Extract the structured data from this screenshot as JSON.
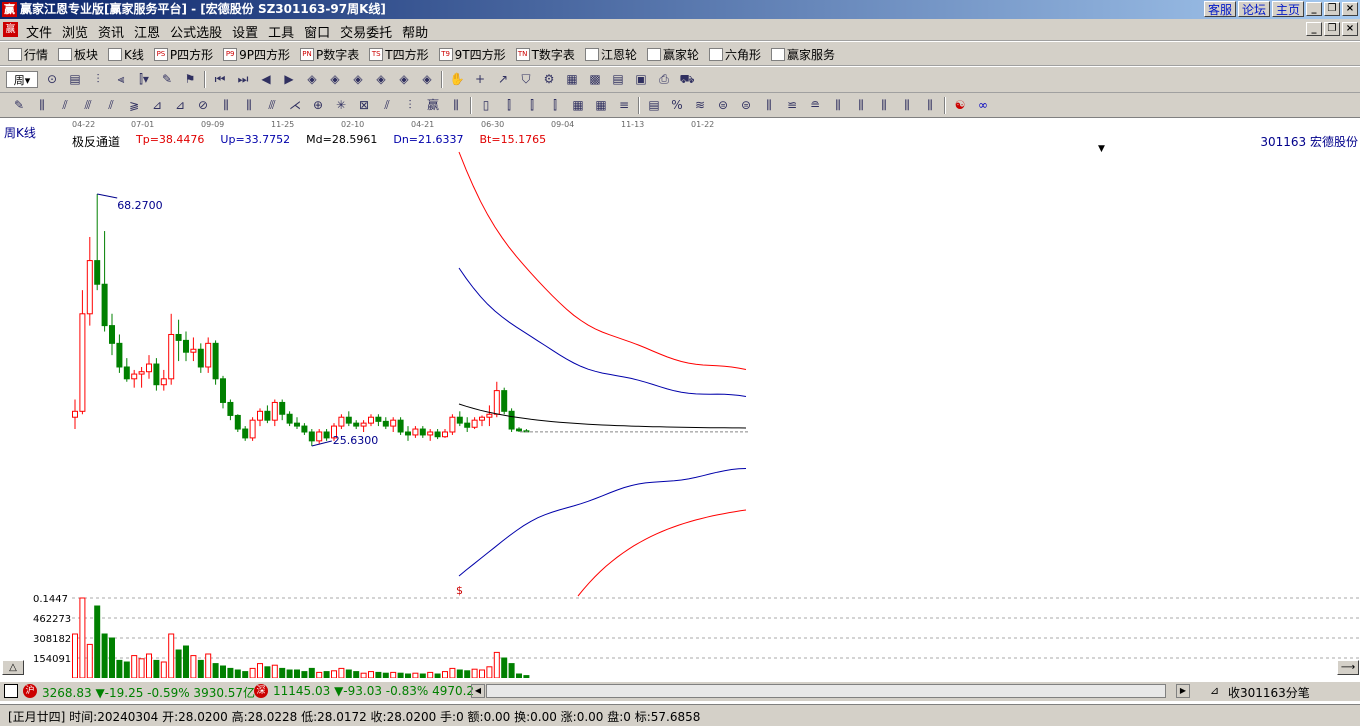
{
  "window": {
    "title": "赢家江恩专业版[赢家服务平台] - [宏德股份  SZ301163-97周K线]",
    "links": [
      "客服",
      "论坛",
      "主页"
    ]
  },
  "menu": [
    "文件",
    "浏览",
    "资讯",
    "江恩",
    "公式选股",
    "设置",
    "工具",
    "窗口",
    "交易委托",
    "帮助"
  ],
  "toolbar1": [
    {
      "label": "行情",
      "icon": "grid-icon"
    },
    {
      "label": "板块",
      "icon": "blocks-icon"
    },
    {
      "label": "K线",
      "icon": "candle-icon"
    },
    {
      "label": "P四方形",
      "icon": "PS"
    },
    {
      "label": "9P四方形",
      "icon": "P9"
    },
    {
      "label": "P数字表",
      "icon": "PN"
    },
    {
      "label": "T四方形",
      "icon": "TS"
    },
    {
      "label": "9T四方形",
      "icon": "T9"
    },
    {
      "label": "T数字表",
      "icon": "TN"
    },
    {
      "label": "江恩轮",
      "icon": "wheel-icon"
    },
    {
      "label": "赢家轮",
      "icon": "wheel-icon"
    },
    {
      "label": "六角形",
      "icon": "hexagon-icon"
    },
    {
      "label": "赢家服务",
      "icon": "dollar-icon"
    }
  ],
  "toolbar2": {
    "period": "周"
  },
  "chart": {
    "period_label": "周K线",
    "dates": [
      "04-22",
      "07-01",
      "09-09",
      "11-25",
      "02-10",
      "04-21",
      "06-30",
      "09-04",
      "11-13",
      "01-22"
    ],
    "indicator": {
      "name": "极反通道",
      "Tp": "Tp=38.4476",
      "Up": "Up=33.7752",
      "Md": "Md=28.5961",
      "Dn": "Dn=21.6337",
      "Bt": "Bt=15.1765"
    },
    "stock": "301163  宏德股份",
    "high_label": "68.2700",
    "low_label": "25.6300",
    "volume_labels": [
      "0.1447",
      "462273",
      "308182",
      "154091"
    ],
    "dollar": "$",
    "colors": {
      "up": "#ff0000",
      "down": "#008000",
      "channel_outer": "#ff0000",
      "channel_inner": "#0000aa",
      "channel_mid": "#000000",
      "text": "#00008b"
    }
  },
  "chart_data": {
    "type": "candlestick",
    "candles": [
      [
        30.5,
        33.5,
        28.5,
        31.5
      ],
      [
        31.5,
        52.0,
        31.0,
        48.0
      ],
      [
        48.0,
        61.0,
        46.0,
        57.0
      ],
      [
        57.0,
        68.27,
        52.0,
        53.0
      ],
      [
        53.0,
        62.0,
        45.0,
        46.0
      ],
      [
        46.0,
        48.0,
        41.0,
        43.0
      ],
      [
        43.0,
        44.5,
        38.0,
        39.0
      ],
      [
        39.0,
        40.5,
        36.5,
        37.0
      ],
      [
        37.0,
        38.5,
        35.5,
        37.8
      ],
      [
        37.8,
        39.0,
        35.5,
        38.2
      ],
      [
        38.2,
        41.0,
        37.0,
        39.5
      ],
      [
        39.5,
        40.5,
        35.0,
        36.0
      ],
      [
        36.0,
        38.5,
        35.0,
        37.0
      ],
      [
        37.0,
        48.0,
        36.0,
        44.5
      ],
      [
        44.5,
        47.0,
        40.0,
        43.5
      ],
      [
        43.5,
        45.0,
        40.0,
        41.5
      ],
      [
        41.5,
        44.0,
        40.0,
        42.0
      ],
      [
        42.0,
        43.0,
        38.0,
        39.0
      ],
      [
        39.0,
        44.0,
        38.0,
        43.0
      ],
      [
        43.0,
        43.5,
        36.0,
        37.0
      ],
      [
        37.0,
        37.5,
        32.0,
        33.0
      ],
      [
        33.0,
        33.5,
        30.0,
        30.8
      ],
      [
        30.8,
        31.0,
        28.0,
        28.5
      ],
      [
        28.5,
        29.0,
        26.5,
        27.0
      ],
      [
        27.0,
        30.5,
        26.5,
        30.0
      ],
      [
        30.0,
        32.0,
        29.0,
        31.5
      ],
      [
        31.5,
        32.5,
        29.5,
        30.0
      ],
      [
        30.0,
        33.5,
        29.0,
        33.0
      ],
      [
        33.0,
        33.5,
        30.0,
        31.0
      ],
      [
        31.0,
        31.5,
        29.0,
        29.5
      ],
      [
        29.5,
        30.5,
        28.5,
        29.0
      ],
      [
        29.0,
        29.5,
        27.5,
        28.0
      ],
      [
        28.0,
        28.5,
        25.63,
        26.5
      ],
      [
        26.5,
        28.5,
        26.0,
        28.0
      ],
      [
        28.0,
        28.5,
        26.5,
        27.0
      ],
      [
        27.0,
        29.5,
        26.5,
        29.0
      ],
      [
        29.0,
        31.0,
        28.5,
        30.5
      ],
      [
        30.5,
        31.5,
        29.0,
        29.5
      ],
      [
        29.5,
        30.0,
        28.5,
        29.0
      ],
      [
        29.0,
        30.0,
        28.0,
        29.5
      ],
      [
        29.5,
        31.0,
        29.0,
        30.5
      ],
      [
        30.5,
        31.0,
        29.0,
        29.8
      ],
      [
        29.8,
        30.5,
        28.5,
        29.0
      ],
      [
        29.0,
        30.5,
        28.0,
        30.0
      ],
      [
        30.0,
        30.5,
        27.5,
        28.0
      ],
      [
        28.0,
        29.0,
        26.5,
        27.5
      ],
      [
        27.5,
        29.0,
        27.0,
        28.5
      ],
      [
        28.5,
        29.0,
        27.0,
        27.5
      ],
      [
        27.5,
        28.5,
        26.5,
        28.0
      ],
      [
        28.0,
        28.5,
        26.8,
        27.2
      ],
      [
        27.2,
        28.5,
        27.0,
        28.0
      ],
      [
        28.0,
        31.0,
        27.5,
        30.5
      ],
      [
        30.5,
        31.5,
        29.0,
        29.5
      ],
      [
        29.5,
        30.5,
        28.0,
        28.8
      ],
      [
        28.8,
        30.5,
        28.5,
        30.0
      ],
      [
        30.0,
        30.8,
        29.0,
        30.5
      ],
      [
        30.5,
        32.5,
        29.0,
        31.0
      ],
      [
        31.0,
        36.5,
        30.5,
        35.0
      ],
      [
        35.0,
        35.5,
        31.0,
        31.5
      ],
      [
        31.5,
        32.0,
        28.0,
        28.5
      ],
      [
        28.5,
        28.8,
        28.0,
        28.2
      ],
      [
        28.2,
        28.5,
        28.0,
        28.02
      ]
    ],
    "volume": [
      0.55,
      1.0,
      0.42,
      0.9,
      0.55,
      0.5,
      0.22,
      0.2,
      0.28,
      0.24,
      0.3,
      0.22,
      0.2,
      0.55,
      0.35,
      0.4,
      0.28,
      0.22,
      0.3,
      0.18,
      0.15,
      0.12,
      0.1,
      0.08,
      0.12,
      0.18,
      0.14,
      0.16,
      0.12,
      0.1,
      0.1,
      0.08,
      0.12,
      0.07,
      0.08,
      0.09,
      0.12,
      0.1,
      0.08,
      0.06,
      0.08,
      0.07,
      0.06,
      0.07,
      0.06,
      0.05,
      0.06,
      0.05,
      0.07,
      0.05,
      0.08,
      0.12,
      0.1,
      0.09,
      0.11,
      0.1,
      0.14,
      0.32,
      0.25,
      0.18,
      0.05,
      0.03
    ],
    "channels": {
      "Tp": 38.4476,
      "Up": 33.7752,
      "Md": 28.5961,
      "Dn": 21.6337,
      "Bt": 15.1765
    },
    "high": 68.27,
    "low": 25.63
  },
  "hscroll": {
    "stats1": "3268.83 ▼-19.25 -0.59% 3930.57亿",
    "stats2": "11145.03 ▼-93.03 -0.83% 4970.2",
    "close": "收301163分笔"
  },
  "status": "[正月廿四] 时间:20240304 开:28.0200 高:28.0228 低:28.0172 收:28.0200 手:0 额:0.00 换:0.00 涨:0.00 盘:0 标:57.6858"
}
